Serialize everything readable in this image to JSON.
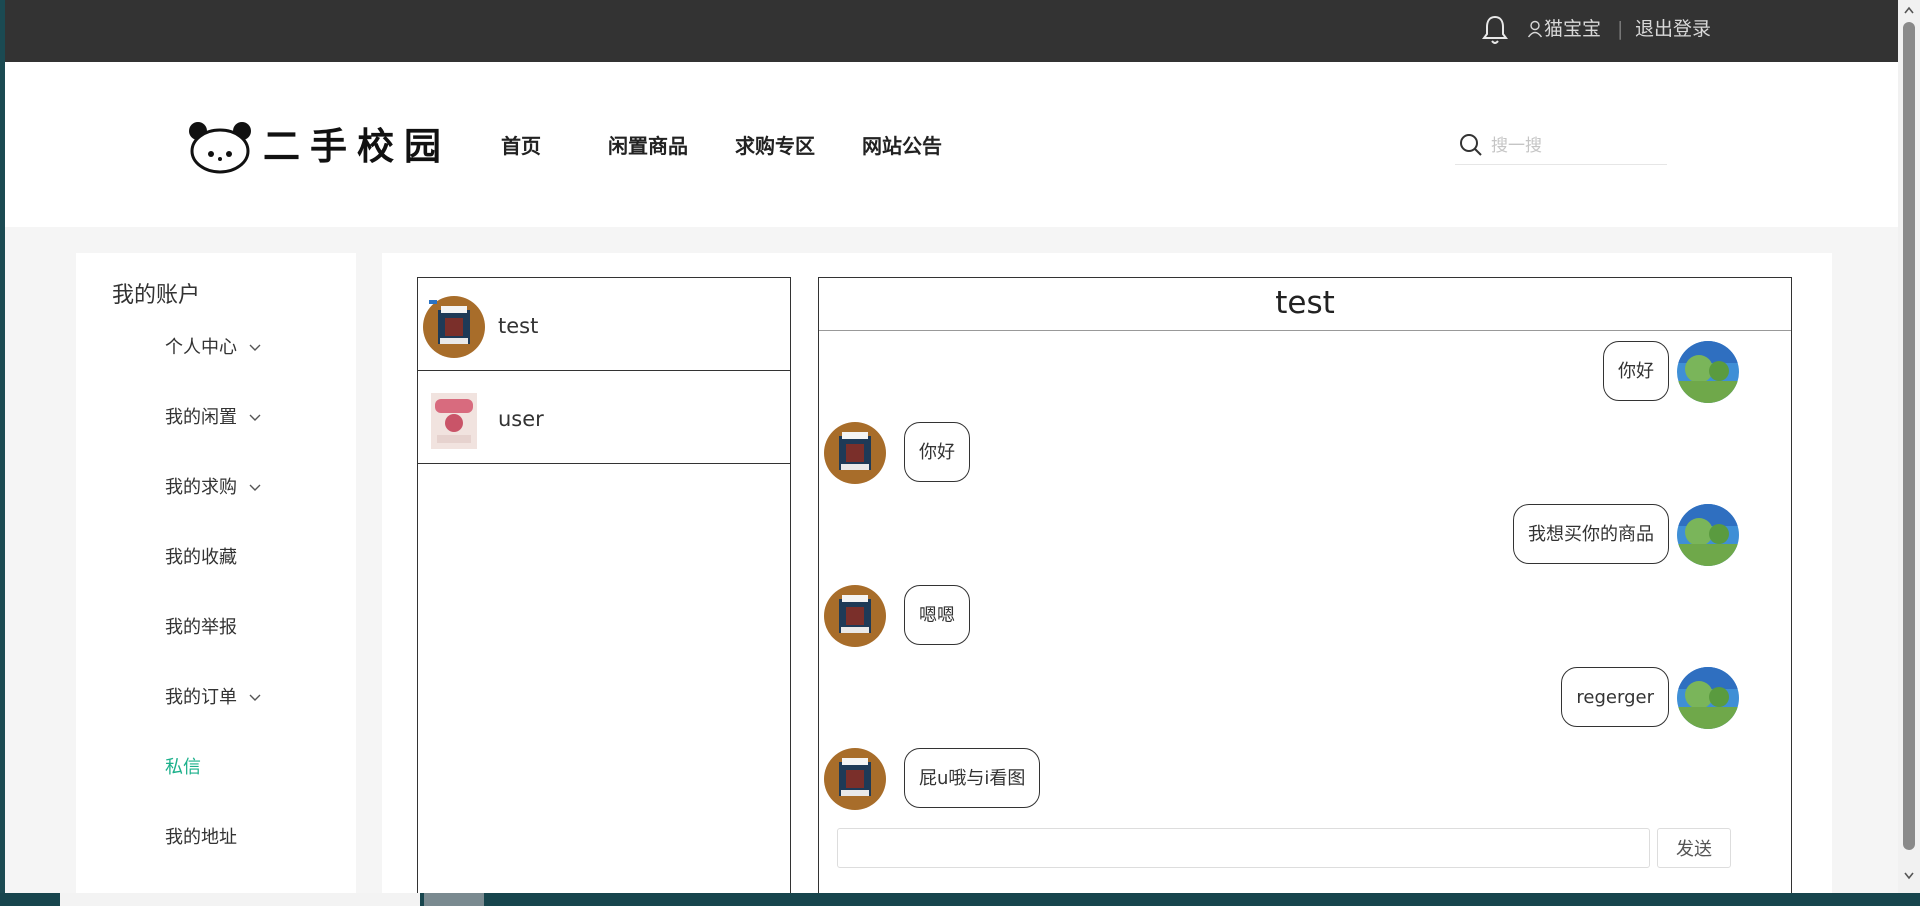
{
  "topbar": {
    "bell_icon": "bell-icon",
    "user_icon": "user-icon",
    "username": "猫宝宝",
    "separator": "|",
    "logout_label": "退出登录"
  },
  "header": {
    "logo_icon": "panda-logo-icon",
    "logo_text": "二手校园",
    "nav": [
      "首页",
      "闲置商品",
      "求购专区",
      "网站公告"
    ],
    "search_icon": "search-icon",
    "search_placeholder": "搜一搜",
    "search_value": ""
  },
  "sidebar": {
    "title": "我的账户",
    "items": [
      {
        "label": "个人中心",
        "has_dropdown": true,
        "active": false
      },
      {
        "label": "我的闲置",
        "has_dropdown": true,
        "active": false
      },
      {
        "label": "我的求购",
        "has_dropdown": true,
        "active": false
      },
      {
        "label": "我的收藏",
        "has_dropdown": false,
        "active": false
      },
      {
        "label": "我的举报",
        "has_dropdown": false,
        "active": false
      },
      {
        "label": "我的订单",
        "has_dropdown": true,
        "active": false
      },
      {
        "label": "私信",
        "has_dropdown": false,
        "active": true
      },
      {
        "label": "我的地址",
        "has_dropdown": false,
        "active": false
      }
    ],
    "active_color": "#1cb08b"
  },
  "contacts": [
    {
      "name": "test",
      "avatar": "product-box-avatar"
    },
    {
      "name": "user",
      "avatar": "product-card-avatar"
    }
  ],
  "chat": {
    "title": "test",
    "messages": [
      {
        "from": "me",
        "text": "你好"
      },
      {
        "from": "other",
        "text": "你好"
      },
      {
        "from": "me",
        "text": "我想买你的商品"
      },
      {
        "from": "other",
        "text": "嗯嗯"
      },
      {
        "from": "me",
        "text": "regerger"
      },
      {
        "from": "other",
        "text": "屁u哦与i看图"
      }
    ],
    "input_value": "",
    "send_label": "发送"
  },
  "colors": {
    "topbar": "#333333",
    "accent": "#1cb08b",
    "page_bg": "#f5f5f5"
  }
}
